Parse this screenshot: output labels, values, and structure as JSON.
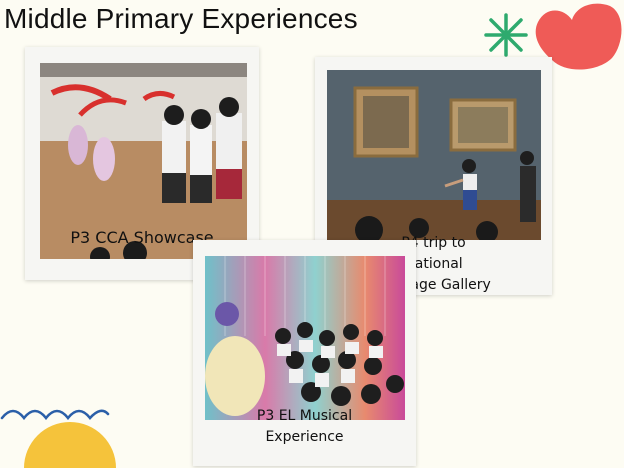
{
  "slide": {
    "title": "Middle Primary Experiences"
  },
  "cards": [
    {
      "caption_lines": [
        "P3 CCA Showcase"
      ]
    },
    {
      "caption_lines": [
        "P4 trip to",
        "National",
        "Heritage Gallery"
      ]
    },
    {
      "caption_lines": [
        "P3 EL Musical",
        "Experience"
      ]
    }
  ],
  "colors": {
    "background": "#fdfcf3",
    "accent_green": "#2eaa6e",
    "accent_coral": "#ef5b57",
    "accent_yellow": "#f5c33b",
    "accent_blue": "#2b5fa8"
  },
  "decorations": [
    "asterisk-icon",
    "coral-petal",
    "yellow-half-circle",
    "blue-scallop-line"
  ]
}
